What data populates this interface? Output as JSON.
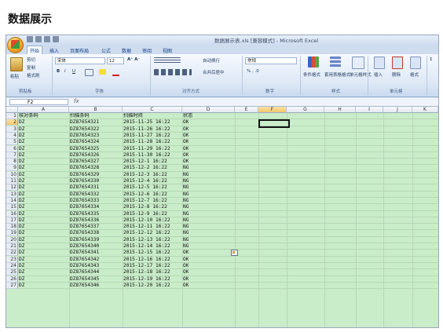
{
  "page": {
    "title": "数据展示"
  },
  "window": {
    "title": "数据展示表.xls [兼容模式] - Microsoft Excel"
  },
  "ribbon": {
    "tabs": [
      "开始",
      "插入",
      "页面布局",
      "公式",
      "数据",
      "审阅",
      "视图"
    ],
    "active_tab": "开始",
    "clipboard": {
      "paste": "粘贴",
      "cut": "剪切",
      "copy": "复制",
      "format_painter": "格式刷",
      "label": "剪贴板"
    },
    "font": {
      "name": "宋体",
      "size": "12",
      "bold": "B",
      "italic": "I",
      "underline": "U",
      "label": "字体"
    },
    "alignment": {
      "wrap": "自动换行",
      "merge": "合并后居中",
      "label": "对齐方式"
    },
    "number": {
      "format": "常规",
      "label": "数字"
    },
    "styles": {
      "conditional": "条件格式",
      "table": "套用表格格式",
      "cell": "单元格样式",
      "label": "样式"
    },
    "cells": {
      "insert": "插入",
      "delete": "删除",
      "format": "格式",
      "label": "单元格"
    }
  },
  "formula_bar": {
    "name_box": "F2",
    "fx": "fx",
    "value": ""
  },
  "sheet": {
    "columns": [
      "A",
      "B",
      "C",
      "D",
      "E",
      "F",
      "G",
      "H",
      "I",
      "J",
      "K"
    ],
    "selected_column": "F",
    "selected_row": "2",
    "header_row": {
      "row": "1",
      "a": "核对条码",
      "b": "扫描条码",
      "c": "扫描时间",
      "d": "状态"
    },
    "rows": [
      {
        "row": "2",
        "a": "DZ",
        "b": "DZ87654321",
        "c": "2015-11-25  16:22",
        "d": "OK"
      },
      {
        "row": "3",
        "a": "DZ",
        "b": "DZ87654322",
        "c": "2015-11-26  16:22",
        "d": "OK"
      },
      {
        "row": "4",
        "a": "DZ",
        "b": "DZ87654323",
        "c": "2015-11-27  16:22",
        "d": "OK"
      },
      {
        "row": "5",
        "a": "DZ",
        "b": "DZ87654324",
        "c": "2015-11-28  16:22",
        "d": "OK"
      },
      {
        "row": "6",
        "a": "DZ",
        "b": "DZ87654325",
        "c": "2015-11-29  16:22",
        "d": "OK"
      },
      {
        "row": "7",
        "a": "DZ",
        "b": "DZ87654326",
        "c": "2015-11-30  16:22",
        "d": "OK"
      },
      {
        "row": "8",
        "a": "DZ",
        "b": "DZ87654327",
        "c": "2015-12-1  16:22",
        "d": "OK"
      },
      {
        "row": "9",
        "a": "DZ",
        "b": "DZ87654328",
        "c": "2015-12-2  16:22",
        "d": "NG"
      },
      {
        "row": "10",
        "a": "DZ",
        "b": "DZ87654329",
        "c": "2015-12-3  16:22",
        "d": "NG"
      },
      {
        "row": "11",
        "a": "DZ",
        "b": "DZ87654330",
        "c": "2015-12-4  16:22",
        "d": "NG"
      },
      {
        "row": "12",
        "a": "DZ",
        "b": "DZ87654331",
        "c": "2015-12-5  16:22",
        "d": "NG"
      },
      {
        "row": "13",
        "a": "DZ",
        "b": "DZ87654332",
        "c": "2015-12-6  16:22",
        "d": "NG"
      },
      {
        "row": "14",
        "a": "DZ",
        "b": "DZ87654333",
        "c": "2015-12-7  16:22",
        "d": "NG"
      },
      {
        "row": "15",
        "a": "DZ",
        "b": "DZ87654334",
        "c": "2015-12-8  16:22",
        "d": "NG"
      },
      {
        "row": "16",
        "a": "DZ",
        "b": "DZ87654335",
        "c": "2015-12-9  16:22",
        "d": "NG"
      },
      {
        "row": "17",
        "a": "DZ",
        "b": "DZ87654336",
        "c": "2015-12-10  16:22",
        "d": "NG"
      },
      {
        "row": "18",
        "a": "DZ",
        "b": "DZ87654337",
        "c": "2015-12-11  16:22",
        "d": "NG"
      },
      {
        "row": "19",
        "a": "DZ",
        "b": "DZ87654338",
        "c": "2015-12-12  16:22",
        "d": "NG"
      },
      {
        "row": "20",
        "a": "DZ",
        "b": "DZ87654339",
        "c": "2015-12-13  16:22",
        "d": "NG"
      },
      {
        "row": "21",
        "a": "DZ",
        "b": "DZ87654340",
        "c": "2015-12-14  16:22",
        "d": "NG"
      },
      {
        "row": "22",
        "a": "DZ",
        "b": "DZ87654341",
        "c": "2015-12-15  16:22",
        "d": "OK"
      },
      {
        "row": "23",
        "a": "DZ",
        "b": "DZ87654342",
        "c": "2015-12-16  16:22",
        "d": "OK"
      },
      {
        "row": "24",
        "a": "DZ",
        "b": "DZ87654343",
        "c": "2015-12-17  16:22",
        "d": "OK"
      },
      {
        "row": "25",
        "a": "DZ",
        "b": "DZ87654344",
        "c": "2015-12-18  16:22",
        "d": "OK"
      },
      {
        "row": "26",
        "a": "DZ",
        "b": "DZ87654345",
        "c": "2015-12-19  16:22",
        "d": "OK"
      },
      {
        "row": "27",
        "a": "DZ",
        "b": "DZ87654346",
        "c": "2015-12-20  16:22",
        "d": "OK"
      }
    ]
  },
  "colors": {
    "sheet_bg": "#c9ecc9",
    "ribbon_bg": "#dde8f6",
    "header_sel": "#f4c66a",
    "tab_text": "#15428b"
  }
}
